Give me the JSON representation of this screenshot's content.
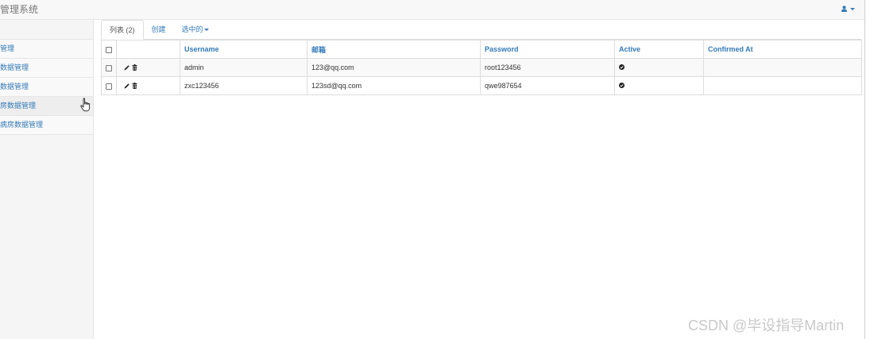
{
  "app": {
    "title": "管理系统"
  },
  "sidebar": {
    "items": [
      {
        "label": "管理"
      },
      {
        "label": "数据管理"
      },
      {
        "label": "数据管理"
      },
      {
        "label": "房数据管理"
      },
      {
        "label": "病房数据管理"
      }
    ]
  },
  "tabs": {
    "list": "列表 (2)",
    "create": "创建",
    "selected": "选中的"
  },
  "table": {
    "headers": [
      "Username",
      "邮箱",
      "Password",
      "Active",
      "Confirmed At"
    ],
    "rows": [
      {
        "username": "admin",
        "email": "123@qq.com",
        "password": "root123456",
        "confirmed_at": ""
      },
      {
        "username": "zxc123456",
        "email": "123sd@qq.com",
        "password": "qwe987654",
        "confirmed_at": ""
      }
    ]
  },
  "watermark": "CSDN @毕设指导Martin",
  "icons": {
    "user": "user-icon",
    "edit": "pencil-icon",
    "delete": "trash-icon",
    "active": "check-circle-icon",
    "cursor": "hand-pointer-icon"
  },
  "colors": {
    "link": "#337ab7",
    "navbar_bg": "#f8f8f8",
    "sidebar_bg": "#f5f5f5"
  }
}
